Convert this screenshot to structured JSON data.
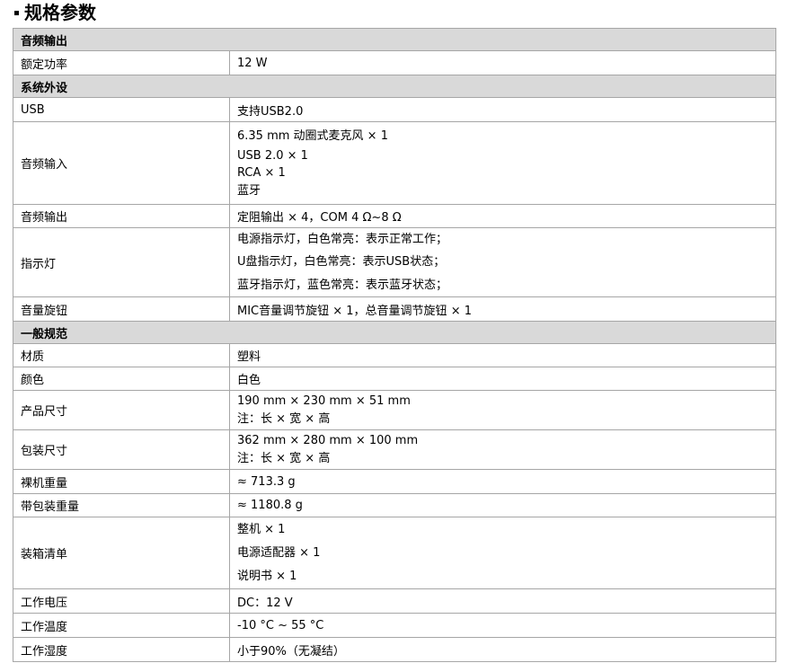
{
  "title": "规格参数",
  "sections": [
    {
      "name": "音频输出",
      "rows": [
        {
          "label": "额定功率",
          "values": [
            "12 W"
          ]
        }
      ]
    },
    {
      "name": "系统外设",
      "rows": [
        {
          "label": "USB",
          "values": [
            "支持USB2.0"
          ]
        },
        {
          "label": "音频输入",
          "values": [
            "6.35 mm  动圈式麦克风  × 1",
            "USB 2.0 × 1",
            "RCA × 1",
            "蓝牙"
          ]
        },
        {
          "label": "音频输出",
          "values": [
            "定阻输出  × 4，COM 4 Ω~8 Ω"
          ]
        },
        {
          "label": "指示灯",
          "values": [
            "电源指示灯，白色常亮：表示正常工作；",
            "U盘指示灯，白色常亮：表示USB状态；",
            "蓝牙指示灯，蓝色常亮：表示蓝牙状态；"
          ]
        },
        {
          "label": "音量旋钮",
          "values": [
            "MIC音量调节旋钮  × 1，总音量调节旋钮  × 1"
          ]
        }
      ]
    },
    {
      "name": "一般规范",
      "rows": [
        {
          "label": "材质",
          "values": [
            "塑料"
          ]
        },
        {
          "label": "颜色",
          "values": [
            "白色"
          ]
        },
        {
          "label": "产品尺寸",
          "values": [
            "190 mm × 230 mm × 51 mm",
            "注：长  ×  宽  ×  高"
          ]
        },
        {
          "label": "包装尺寸",
          "values": [
            "362 mm × 280 mm × 100 mm",
            "注：长  ×  宽  ×  高"
          ]
        },
        {
          "label": "裸机重量",
          "values": [
            "≈ 713.3 g"
          ]
        },
        {
          "label": "带包装重量",
          "values": [
            "≈ 1180.8 g"
          ]
        },
        {
          "label": "装箱清单",
          "values": [
            "整机  × 1",
            "电源适配器  × 1",
            "说明书  × 1"
          ]
        },
        {
          "label": "工作电压",
          "values": [
            "DC：12 V"
          ]
        },
        {
          "label": "工作温度",
          "values": [
            "-10 °C ~ 55 °C"
          ]
        },
        {
          "label": "工作湿度",
          "values": [
            "小于90%（无凝结）"
          ]
        }
      ]
    }
  ]
}
